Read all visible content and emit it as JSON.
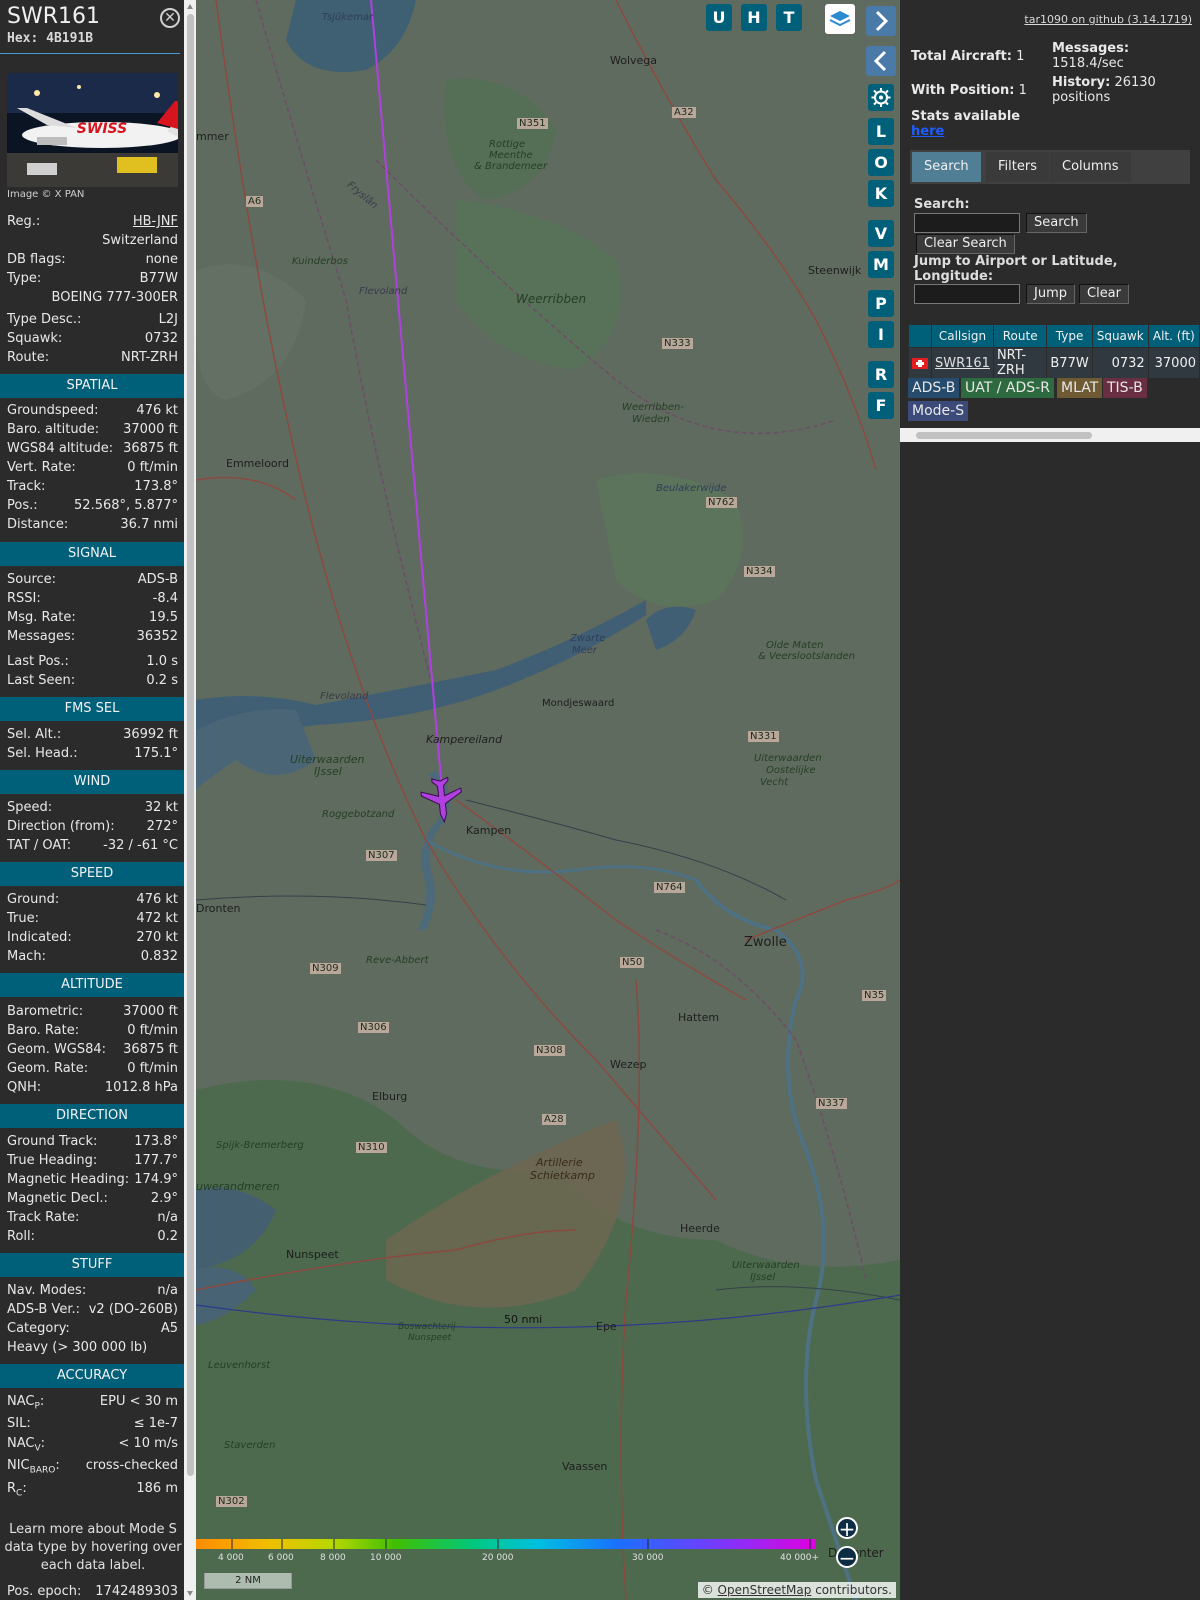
{
  "aircraft": {
    "callsign": "SWR161",
    "hex_label": "Hex:",
    "hex": "4B191B",
    "image_credit": "Image © X PAN",
    "photo_logo": "SWISS"
  },
  "info_rows": {
    "reg_k": "Reg.:",
    "reg_v": "HB-JNF",
    "country": "Switzerland",
    "dbflags_k": "DB flags:",
    "dbflags_v": "none",
    "type_k": "Type:",
    "type_v": "B77W",
    "type_full": "BOEING 777-300ER",
    "typedesc_k": "Type Desc.:",
    "typedesc_v": "L2J",
    "squawk_k": "Squawk:",
    "squawk_v": "0732",
    "route_k": "Route:",
    "route_v": "NRT-ZRH"
  },
  "sections": {
    "spatial": "SPATIAL",
    "signal": "SIGNAL",
    "fms": "FMS SEL",
    "wind": "WIND",
    "speed": "SPEED",
    "altitude": "ALTITUDE",
    "direction": "DIRECTION",
    "stuff": "STUFF",
    "accuracy": "ACCURACY"
  },
  "spatial": {
    "gs_k": "Groundspeed:",
    "gs_v": "476 kt",
    "baro_k": "Baro. altitude:",
    "baro_v": "37000 ft",
    "wgs_k": "WGS84 altitude:",
    "wgs_v": "36875 ft",
    "vr_k": "Vert. Rate:",
    "vr_v": "0 ft/min",
    "track_k": "Track:",
    "track_v": "173.8°",
    "pos_k": "Pos.:",
    "pos_v": "52.568°, 5.877°",
    "dist_k": "Distance:",
    "dist_v": "36.7 nmi"
  },
  "signal": {
    "src_k": "Source:",
    "src_v": "ADS-B",
    "rssi_k": "RSSI:",
    "rssi_v": "-8.4",
    "msgrate_k": "Msg. Rate:",
    "msgrate_v": "19.5",
    "msgs_k": "Messages:",
    "msgs_v": "36352",
    "lastpos_k": "Last Pos.:",
    "lastpos_v": "1.0 s",
    "lastseen_k": "Last Seen:",
    "lastseen_v": "0.2 s"
  },
  "fms": {
    "selalt_k": "Sel. Alt.:",
    "selalt_v": "36992 ft",
    "selhead_k": "Sel. Head.:",
    "selhead_v": "175.1°"
  },
  "wind": {
    "speed_k": "Speed:",
    "speed_v": "32 kt",
    "dir_k": "Direction (from):",
    "dir_v": "272°",
    "tat_k": "TAT / OAT:",
    "tat_v": "-32 / -61 °C"
  },
  "speed": {
    "ground_k": "Ground:",
    "ground_v": "476 kt",
    "true_k": "True:",
    "true_v": "472 kt",
    "ind_k": "Indicated:",
    "ind_v": "270 kt",
    "mach_k": "Mach:",
    "mach_v": "0.832"
  },
  "altitude": {
    "baro_k": "Barometric:",
    "baro_v": "37000 ft",
    "barorate_k": "Baro. Rate:",
    "barorate_v": "0 ft/min",
    "geom_k": "Geom. WGS84:",
    "geom_v": "36875 ft",
    "geomrate_k": "Geom. Rate:",
    "geomrate_v": "0 ft/min",
    "qnh_k": "QNH:",
    "qnh_v": "1012.8 hPa"
  },
  "direction": {
    "gtrack_k": "Ground Track:",
    "gtrack_v": "173.8°",
    "thead_k": "True Heading:",
    "thead_v": "177.7°",
    "mhead_k": "Magnetic Heading:",
    "mhead_v": "174.9°",
    "mdecl_k": "Magnetic Decl.:",
    "mdecl_v": "2.9°",
    "trate_k": "Track Rate:",
    "trate_v": "n/a",
    "roll_k": "Roll:",
    "roll_v": "0.2"
  },
  "stuff": {
    "nav_k": "Nav. Modes:",
    "nav_v": "n/a",
    "adsb_k": "ADS-B Ver.:",
    "adsb_v": "v2 (DO-260B)",
    "cat_k": "Category:",
    "cat_v": "A5",
    "cat_desc": "Heavy (> 300 000 lb)"
  },
  "accuracy": {
    "nacp_k": "NAC",
    "nacp_sub": "P",
    "nacp_v": "EPU < 30 m",
    "sil_k": "SIL:",
    "sil_v": "≤ 1e-7",
    "nacv_k": "NAC",
    "nacv_sub": "V",
    "nacv_v": "< 10 m/s",
    "nicbaro_k": "NIC",
    "nicbaro_sub": "BARO",
    "nicbaro_v": "cross-checked",
    "rc_k": "R",
    "rc_sub": "C",
    "rc_v": "186 m"
  },
  "note": "Learn more about Mode S data type by hovering over each data label.",
  "epoch_k": "Pos. epoch:",
  "epoch_v": "1742489303",
  "map": {
    "buttons": [
      "U",
      "H",
      "T"
    ],
    "side_buttons": [
      "L",
      "O",
      "K",
      "V",
      "M",
      "P",
      "I",
      "R",
      "F"
    ],
    "range_label": "50 nmi",
    "scale": "2 NM",
    "attribution_prefix": "© ",
    "attribution_link": "OpenStreetMap",
    "attribution_suffix": " contributors.",
    "colorbar_labels": [
      "4 000",
      "6 000",
      "8 000",
      "10 000",
      "20 000",
      "30 000",
      "40 000+"
    ],
    "places": {
      "tsjukemar": "Tsjûkemar",
      "wolvega": "Wolvega",
      "n351": "N351",
      "a32": "A32",
      "a6": "A6",
      "rottige": "Rottige",
      "meenthe": "Meenthe",
      "brandemeer": "& Brandemeer",
      "fryslan": "Fryslân",
      "kuinderbos": "Kuinderbos",
      "flevoland1": "Flevoland",
      "weerribben": "Weerribben",
      "steenwijk": "Steenwijk",
      "n333": "N333",
      "weerribben_wieden1": "Weerribben-",
      "weerribben_wieden2": "Wieden",
      "emmeloord": "Emmeloord",
      "beulakerwijde": "Beulakerwijde",
      "n762": "N762",
      "n334": "N334",
      "zwarte1": "Zwarte",
      "zwarte2": "Meer",
      "mondjeswaard": "Mondjeswaard",
      "oldemeer1": "Olde Maten",
      "oldemeer2": "& Veerslootslanden",
      "flevoland2": "Flevoland",
      "kampereiland": "Kampereiland",
      "uiterwaarden1": "Uiterwaarden",
      "uiterwaarden2": "IJssel",
      "roggebotzand": "Roggebotzand",
      "n331": "N331",
      "uiterwaarden_oost1": "Uiterwaarden",
      "uiterwaarden_oost2": "Oostelijke",
      "uiterwaarden_oost3": "Vecht",
      "kampen": "Kampen",
      "n307": "N307",
      "dronten": "Dronten",
      "n764": "N764",
      "zwolle": "Zwolle",
      "reve": "Reve-Abbert",
      "n309": "N309",
      "n50": "N50",
      "n35": "N35",
      "hattem": "Hattem",
      "n306": "N306",
      "n308": "N308",
      "wezep": "Wezep",
      "elburg": "Elburg",
      "n337": "N337",
      "a28": "A28",
      "spijk": "Spijk-Bremerberg",
      "n310": "N310",
      "artillerie1": "Artillerie",
      "artillerie2": "Schietkamp",
      "uwerandmeren": "uwerandmeren",
      "heerde": "Heerde",
      "nunspeet": "Nunspeet",
      "epe": "Epe",
      "boswachterij1": "Boswachterij",
      "boswachterij2": "Nunspeet",
      "leuvenhorst": "Leuvenhorst",
      "staverden": "Staverden",
      "vaassen": "Vaassen",
      "n302": "N302",
      "deventer": "Deventer",
      "emmer": "mmer",
      "uiterwaarden_ijssel_s1": "Uiterwaarden",
      "uiterwaarden_ijssel_s2": "IJssel"
    }
  },
  "sidebar": {
    "github": "tar1090 on github (3.14.1719)",
    "total_k": "Total Aircraft:",
    "total_v": "1",
    "withpos_k": "With Position:",
    "withpos_v": "1",
    "stats_k": "Stats available",
    "stats_link": "here",
    "messages_k": "Messages:",
    "messages_v": "1518.4/sec",
    "history_k": "History:",
    "history_v": "26130 positions",
    "tabs": [
      "Search",
      "Filters",
      "Columns"
    ],
    "search_label": "Search:",
    "search_btn": "Search",
    "clear_search_btn": "Clear Search",
    "jump_label": "Jump to Airport or Latitude, Longitude:",
    "jump_btn": "Jump",
    "clear_btn": "Clear",
    "columns": [
      "Callsign",
      "Route",
      "Type",
      "Squawk",
      "Alt. (ft)"
    ],
    "row": {
      "callsign": "SWR161",
      "route": "NRT-ZRH",
      "type": "B77W",
      "squawk": "0732",
      "alt": "37000"
    },
    "chips": [
      {
        "label": "ADS-B",
        "color": "#264b6c"
      },
      {
        "label": "UAT / ADS-R",
        "color": "#2e6a40"
      },
      {
        "label": "MLAT",
        "color": "#6e5a32"
      },
      {
        "label": "TIS-B",
        "color": "#6a2e42"
      },
      {
        "label": "Mode-S",
        "color": "#3b4a78"
      }
    ]
  }
}
